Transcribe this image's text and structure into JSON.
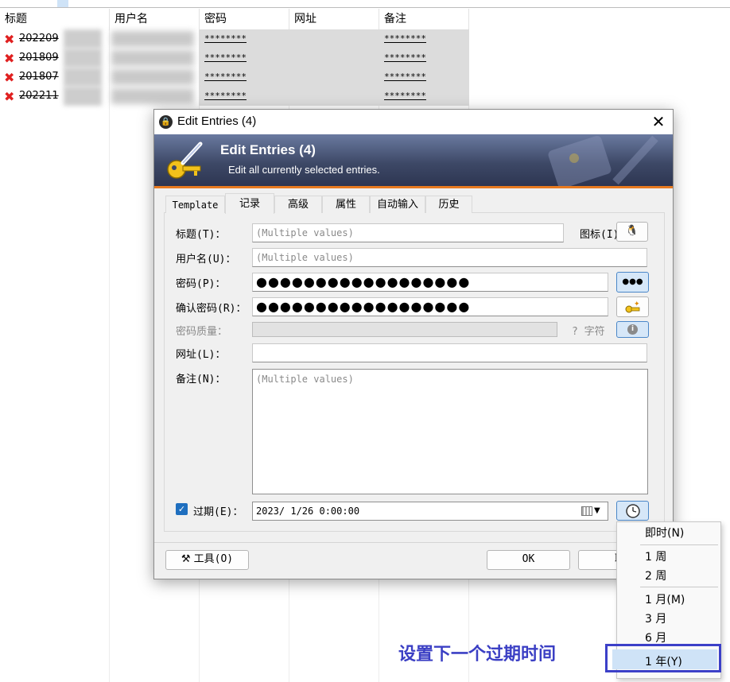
{
  "list": {
    "columns": [
      "标题",
      "用户名",
      "密码",
      "网址",
      "备注"
    ],
    "rows": [
      {
        "title": "202209",
        "password": "********",
        "notes": "********"
      },
      {
        "title": "201809",
        "password": "********",
        "notes": "********"
      },
      {
        "title": "201807",
        "password": "********",
        "notes": "********"
      },
      {
        "title": "202211",
        "password": "********",
        "notes": "********"
      }
    ]
  },
  "dialog": {
    "window_title": "Edit Entries (4)",
    "banner_title": "Edit Entries (4)",
    "banner_subtitle": "Edit all currently selected entries.",
    "tabs": [
      "Template",
      "记录",
      "高级",
      "属性",
      "自动输入",
      "历史"
    ],
    "active_tab": "记录",
    "fields": {
      "title_label": "标题(T)：",
      "title_placeholder": "(Multiple values)",
      "icon_label": "图标(I)：",
      "username_label": "用户名(U)：",
      "username_placeholder": "(Multiple values)",
      "password_label": "密码(P)：",
      "password_value": "●●●●●●●●●●●●●●●●●●",
      "show_password_label": "●●●",
      "confirm_label": "确认密码(R)：",
      "confirm_value": "●●●●●●●●●●●●●●●●●●",
      "quality_label": "密码质量：",
      "quality_text": "? 字符",
      "url_label": "网址(L)：",
      "notes_label": "备注(N)：",
      "notes_placeholder": "(Multiple values)",
      "expires_label": "过期(E)：",
      "expires_checked": true,
      "expires_value": "2023/ 1/26   0:00:00"
    },
    "buttons": {
      "tools": "工具(O)",
      "ok": "OK",
      "cancel": "取"
    }
  },
  "expiry_menu": {
    "items": [
      "即时(N)",
      "1 周",
      "2 周",
      "1 月(M)",
      "3 月",
      "6 月",
      "1 年(Y)"
    ],
    "highlighted": "1 年(Y)"
  },
  "annotation": "设置下一个过期时间",
  "colors": {
    "accent": "#3c40c8",
    "banner_dark": "#2c3450",
    "banner_edge": "#e87a1f",
    "delete_red": "#e02020"
  }
}
